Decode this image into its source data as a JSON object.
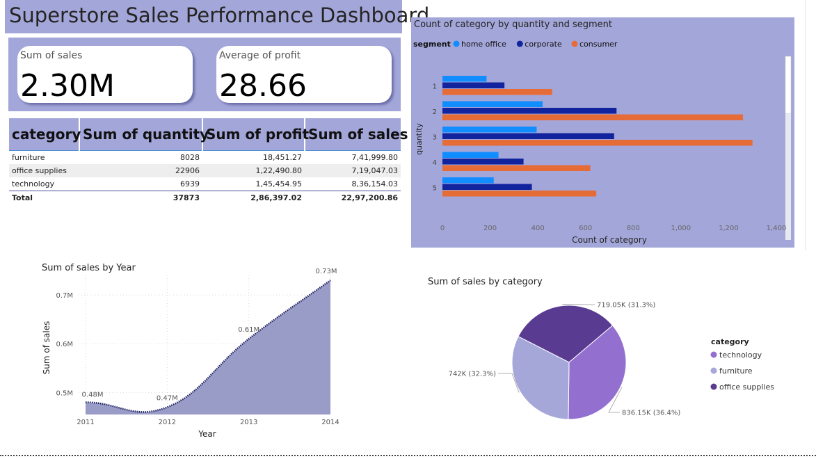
{
  "title": "Superstore Sales Performance Dashboard",
  "kpis": [
    {
      "label": "Sum of sales",
      "value": "2.30M"
    },
    {
      "label": "Average of profit",
      "value": "28.66"
    }
  ],
  "table": {
    "headers": [
      "category",
      "Sum of quantity",
      "Sum of profit",
      "Sum of sales"
    ],
    "rows": [
      [
        "furniture",
        "8028",
        "18,451.27",
        "7,41,999.80"
      ],
      [
        "office supplies",
        "22906",
        "1,22,490.80",
        "7,19,047.03"
      ],
      [
        "technology",
        "6939",
        "1,45,454.95",
        "8,36,154.03"
      ]
    ],
    "total": [
      "Total",
      "37873",
      "2,86,397.02",
      "22,97,200.86"
    ]
  },
  "colors": {
    "panel": "#a3a6d9",
    "home_office": "#118dff",
    "corporate": "#12239e",
    "consumer": "#e66c37",
    "area": "#9a9cc8",
    "technology": "#9370cf",
    "furniture": "#a6a7d9",
    "office_supplies": "#5a3b92"
  },
  "chart_data": [
    {
      "type": "bar",
      "orientation": "horizontal",
      "title": "Count of category by quantity and segment",
      "legend_title": "segment",
      "legend_position": "top-left",
      "xlabel": "Count of category",
      "ylabel": "quantity",
      "xlim": [
        0,
        1400
      ],
      "xticks": [
        "0",
        "200",
        "400",
        "600",
        "800",
        "1,000",
        "1,200",
        "1,400"
      ],
      "categories": [
        "1",
        "2",
        "3",
        "4",
        "5"
      ],
      "series": [
        {
          "name": "home office",
          "values": [
            185,
            420,
            395,
            235,
            215
          ]
        },
        {
          "name": "corporate",
          "values": [
            260,
            730,
            720,
            340,
            375
          ]
        },
        {
          "name": "consumer",
          "values": [
            460,
            1260,
            1300,
            620,
            645
          ]
        }
      ]
    },
    {
      "type": "area",
      "title": "Sum of sales by Year",
      "xlabel": "Year",
      "ylabel": "Sum of sales",
      "x": [
        "2011",
        "2012",
        "2013",
        "2014"
      ],
      "y": [
        0.48,
        0.47,
        0.61,
        0.73
      ],
      "data_labels": [
        "0.48M",
        "0.47M",
        "0.61M",
        "0.73M"
      ],
      "yticks": [
        "0.5M",
        "0.6M",
        "0.7M"
      ],
      "ylim": [
        0.455,
        0.74
      ],
      "grid": true
    },
    {
      "type": "pie",
      "title": "Sum of sales by category",
      "legend_title": "category",
      "legend_position": "right",
      "slices": [
        {
          "label": "technology",
          "value": 836.15,
          "text": "836.15K (36.4%)"
        },
        {
          "label": "furniture",
          "value": 742,
          "text": "742K (32.3%)"
        },
        {
          "label": "office supplies",
          "value": 719.05,
          "text": "719.05K (31.3%)"
        }
      ]
    }
  ]
}
